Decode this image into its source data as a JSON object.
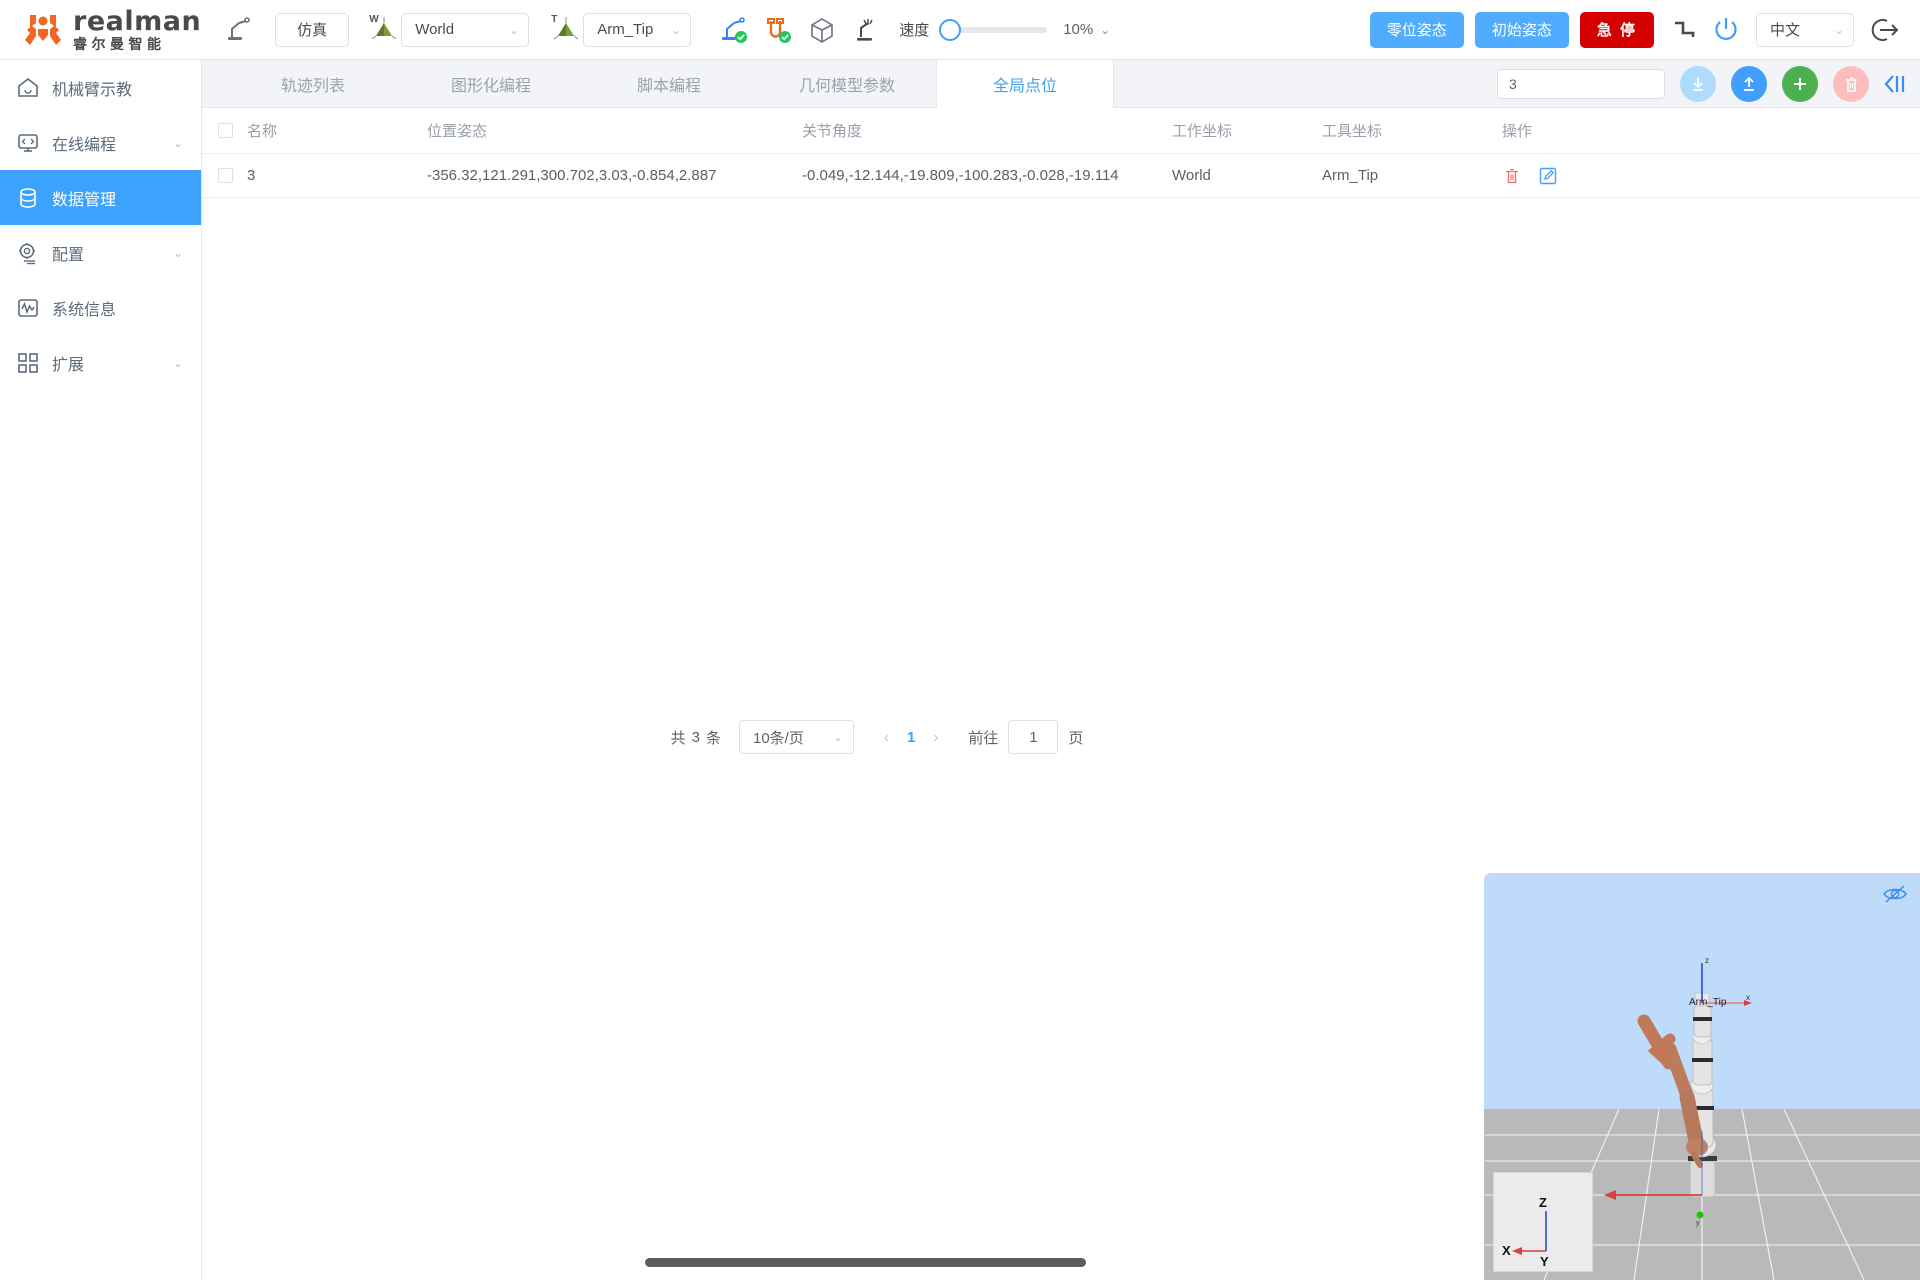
{
  "brand": {
    "name": "realman",
    "subtitle": "睿尔曼智能"
  },
  "toolbar": {
    "sim_mode_label": "仿真",
    "world_frame": {
      "badge": "W",
      "value": "World"
    },
    "tool_frame": {
      "badge": "T",
      "value": "Arm_Tip"
    },
    "icons": [
      "robot-connected-icon",
      "link-connected-icon",
      "cube-icon",
      "teach-icon"
    ],
    "speed_label": "速度",
    "speed_percent": "10%",
    "zero_pose_label": "零位姿态",
    "init_pose_label": "初始姿态",
    "estop_label": "急 停",
    "language": "中文",
    "accent_blue": "#4facfe",
    "estop_red": "#d40000"
  },
  "sidebar": {
    "items": [
      {
        "label": "机械臂示教",
        "icon": "home-icon",
        "caret": "",
        "active": false
      },
      {
        "label": "在线编程",
        "icon": "code-monitor-icon",
        "caret": "⌄",
        "active": false
      },
      {
        "label": "数据管理",
        "icon": "database-icon",
        "caret": "",
        "active": true
      },
      {
        "label": "配置",
        "icon": "gear-icon",
        "caret": "⌄",
        "active": false
      },
      {
        "label": "系统信息",
        "icon": "pulse-icon",
        "caret": "",
        "active": false
      },
      {
        "label": "扩展",
        "icon": "grid-icon",
        "caret": "⌄",
        "active": false
      }
    ]
  },
  "tabs": [
    {
      "label": "轨迹列表",
      "active": false
    },
    {
      "label": "图形化编程",
      "active": false
    },
    {
      "label": "脚本编程",
      "active": false
    },
    {
      "label": "几何模型参数",
      "active": false
    },
    {
      "label": "全局点位",
      "active": true
    }
  ],
  "search": {
    "value": "3",
    "placeholder": ""
  },
  "actions": {
    "download_label": "download-button",
    "upload_label": "upload-button",
    "add_label": "add-button",
    "delete_label": "delete-button",
    "collapse_label": "collapse-panel-button"
  },
  "table": {
    "headers": {
      "name": "名称",
      "pose": "位置姿态",
      "joint": "关节角度",
      "work": "工作坐标",
      "tool": "工具坐标",
      "op": "操作"
    },
    "rows": [
      {
        "name": "3",
        "pose": "-356.32,121.291,300.702,3.03,-0.854,2.887",
        "joint": "-0.049,-12.144,-19.809,-100.283,-0.028,-19.114",
        "work": "World",
        "tool": "Arm_Tip"
      }
    ]
  },
  "pagination": {
    "total_prefix": "共",
    "total_count": "3",
    "total_suffix": "条",
    "page_size": "10条/页",
    "prev": "‹",
    "current_page": "1",
    "next": "›",
    "goto_label": "前往",
    "goto_value": "1",
    "page_unit": "页"
  },
  "viewport": {
    "frame_label": "Arm_Tip",
    "axis_z": "z",
    "axis_x": "x",
    "gizmo_x": "X",
    "gizmo_y": "Y",
    "gizmo_z": "Z",
    "eye_icon": "hide-eye-icon",
    "sky_color": "#bedcfa",
    "floor_color": "#b9b9b9"
  }
}
